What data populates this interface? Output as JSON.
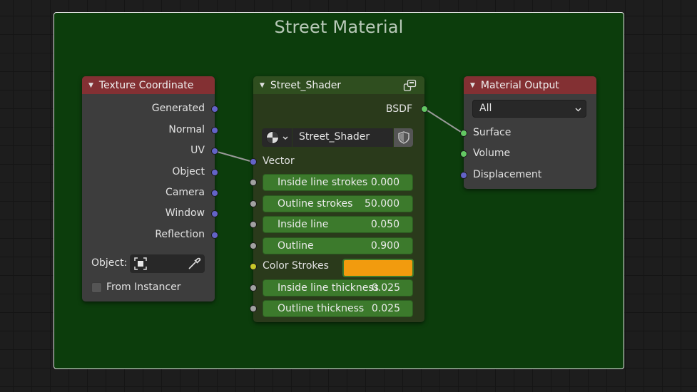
{
  "frame": {
    "title": "Street Material",
    "color": "#0c3d0c"
  },
  "texture_coordinate": {
    "title": "Texture Coordinate",
    "outputs": [
      "Generated",
      "Normal",
      "UV",
      "Object",
      "Camera",
      "Window",
      "Reflection"
    ],
    "object_label": "Object:",
    "from_instancer_label": "From Instancer"
  },
  "street_shader": {
    "title": "Street_Shader",
    "output_label": "BSDF",
    "node_group_name": "Street_Shader",
    "vector_label": "Vector",
    "inputs": [
      {
        "label": "Inside line strokes",
        "value": "0.000"
      },
      {
        "label": "Outline strokes",
        "value": "50.000"
      },
      {
        "label": "Inside line",
        "value": "0.050"
      },
      {
        "label": "Outline",
        "value": "0.900"
      }
    ],
    "color_strokes_label": "Color Strokes",
    "color_strokes_value": "#f29b0e",
    "inputs2": [
      {
        "label": "Inside line thickness",
        "value": "0.025"
      },
      {
        "label": "Outline thickness",
        "value": "0.025"
      }
    ]
  },
  "material_output": {
    "title": "Material Output",
    "target": "All",
    "inputs": [
      "Surface",
      "Volume",
      "Displacement"
    ]
  },
  "icons": {
    "collapse": "triangle-down-icon",
    "node_group": "node-group-icon",
    "material_sphere": "material-sphere-icon",
    "fake_user": "shield-icon",
    "object_select": "object-icon",
    "eyedropper": "eyedropper-icon"
  }
}
